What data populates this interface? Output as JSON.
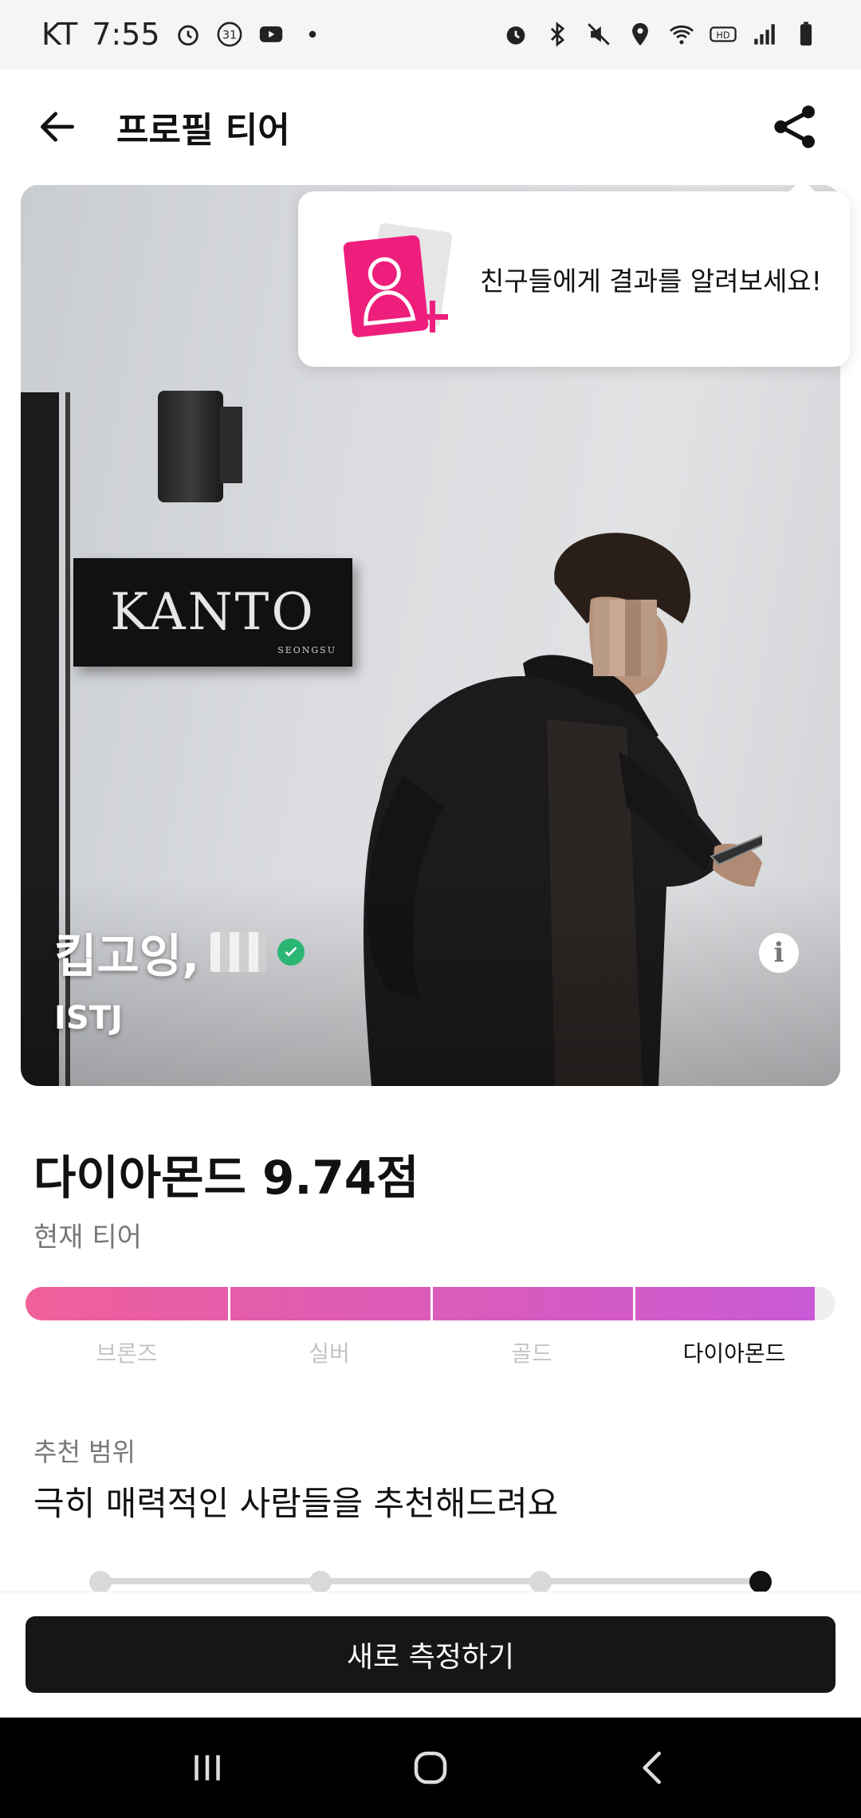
{
  "status_bar": {
    "carrier": "KT",
    "time": "7:55",
    "calendar_day": "31",
    "icons_left": [
      "alarm-icon",
      "calendar-icon",
      "youtube-icon",
      "dot-icon"
    ],
    "icons_right": [
      "alarm-icon",
      "bluetooth-icon",
      "mute-icon",
      "location-icon",
      "wifi-icon",
      "hd-icon",
      "signal-icon",
      "battery-icon"
    ],
    "hd_label": "HD"
  },
  "app_bar": {
    "title": "프로필 티어",
    "back_icon": "arrow-left-icon",
    "share_icon": "share-icon"
  },
  "tooltip": {
    "text": "친구들에게 결과를 알려보세요!",
    "icon": "add-profile-card-icon"
  },
  "photo": {
    "sign_text": "KANTO",
    "sign_subtext": "SEONGSU"
  },
  "profile": {
    "name": "킵고잉,",
    "mbti": "ISTJ",
    "verified_icon": "check-icon",
    "info_icon": "info-icon",
    "info_glyph": "i"
  },
  "tier": {
    "score_text": "다이아몬드 9.74점",
    "caption": "현재 티어",
    "levels": [
      "브론즈",
      "실버",
      "골드",
      "다이아몬드"
    ],
    "current_index": 3,
    "fill_fraction": 0.974,
    "colors": {
      "bar_start": "#f0609a",
      "bar_mid": "#e05cb2",
      "bar_end": "#c85ad6",
      "track": "#f0eef1",
      "label_inactive": "#c4c4c4",
      "label_active": "#111111"
    }
  },
  "recommendation": {
    "caption": "추천 범위",
    "text": "극히 매력적인 사람들을 추천해드려요",
    "steps": 4,
    "current_step": 3
  },
  "actions": {
    "remeasure_label": "새로 측정하기"
  },
  "nav_bar": {
    "items": [
      "recent-apps-icon",
      "home-icon",
      "back-icon"
    ]
  }
}
